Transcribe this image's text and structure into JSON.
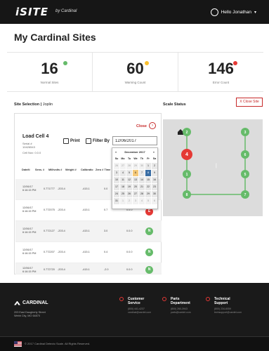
{
  "header": {
    "logo": "iSITE",
    "logo_sub": "by Cardinal",
    "user_greeting": "Hello Jonathan"
  },
  "page": {
    "title": "My Cardinal Sites"
  },
  "stats": [
    {
      "value": "16",
      "label": "Normal Sites",
      "color": "#66bb6a"
    },
    {
      "value": "60",
      "label": "Warning Count",
      "color": "#fbc02d"
    },
    {
      "value": "146",
      "label": "Error Count",
      "color": "#e53935"
    }
  ],
  "site_selection": {
    "label": "Site Selection",
    "site": "Joplin"
  },
  "scale_status": {
    "label": "Scale Status",
    "close_all": "X Close Site"
  },
  "load_cell": {
    "title": "Load Cell 4",
    "serial_label": "Serial #",
    "serial": "10426543",
    "cell_no": "Cell Nov: 0.0.0",
    "close_label": "Close",
    "print_label": "Print",
    "filter_label": "Filter By",
    "date_value": "12/06/2017"
  },
  "table": {
    "headers": [
      "Date/ti",
      "Sens. #",
      "Millivolts #",
      "Weight #",
      "Calibratio",
      "Zero # Time"
    ],
    "rows": [
      {
        "date": "12/06/17 6:16:15 PM",
        "sensor": "0.771777",
        "mv": "-203.4",
        "weight": "-415.1",
        "cal": "0.0",
        "zero": "",
        "status": "",
        "status_type": "none"
      },
      {
        "date": "12/06/17 6:16:15 PM",
        "sensor": "0.772075",
        "mv": "-203.4",
        "weight": "-415.1",
        "cal": "0.7",
        "zero": "0.0.0",
        "status": "E",
        "status_type": "red"
      },
      {
        "date": "12/06/17 6:16:15 PM",
        "sensor": "0.772127",
        "mv": "-203.4",
        "weight": "-415.1",
        "cal": "3.0",
        "zero": "0.0.0",
        "status": "N",
        "status_type": "green"
      },
      {
        "date": "12/06/17 6:16:15 PM",
        "sensor": "0.772207",
        "mv": "-203.4",
        "weight": "-415.1",
        "cal": "0.4",
        "zero": "0.0.0",
        "status": "N",
        "status_type": "green"
      },
      {
        "date": "12/06/17 6:16:15 PM",
        "sensor": "0.772720",
        "mv": "-203.4",
        "weight": "-415.1",
        "cal": "-2.0",
        "zero": "0.0.0",
        "status": "N",
        "status_type": "green"
      }
    ]
  },
  "calendar": {
    "month": "December 2017",
    "prev": "«",
    "next": "»",
    "dow": [
      "Su",
      "Mo",
      "Tu",
      "We",
      "Th",
      "Fr",
      "Sa"
    ],
    "weeks": [
      [
        "26",
        "27",
        "28",
        "29",
        "30",
        "1",
        "2"
      ],
      [
        "3",
        "4",
        "5",
        "6",
        "7",
        "8",
        "9"
      ],
      [
        "10",
        "11",
        "12",
        "13",
        "14",
        "15",
        "16"
      ],
      [
        "17",
        "18",
        "19",
        "20",
        "21",
        "22",
        "23"
      ],
      [
        "24",
        "25",
        "26",
        "27",
        "28",
        "29",
        "30"
      ],
      [
        "31",
        "1",
        "2",
        "3",
        "4",
        "5",
        "6"
      ]
    ],
    "selected_day": "6",
    "today_day": "8"
  },
  "scale_nodes": [
    {
      "label": "2",
      "color": "#66bb6a"
    },
    {
      "label": "3",
      "color": "#66bb6a"
    },
    {
      "label": "4",
      "color": "#e53935"
    },
    {
      "label": "6",
      "color": "#66bb6a"
    },
    {
      "label": "5",
      "color": "#66bb6a"
    },
    {
      "label": "1",
      "color": "#66bb6a"
    },
    {
      "label": "8",
      "color": "#66bb6a"
    },
    {
      "label": "7",
      "color": "#66bb6a"
    }
  ],
  "footer": {
    "brand": "CARDINAL",
    "address_1": "203 East Daugherty Street",
    "address_2": "Webb City, MO 64870",
    "cols": [
      {
        "title_1": "Customer",
        "title_2": "Service",
        "line_1": "(800) 441-4237",
        "line_2": "cardinal@cardet.com"
      },
      {
        "title_1": "Parts",
        "title_2": "Department",
        "line_1": "(800) 260-3943",
        "line_2": "parts@cardet.com"
      },
      {
        "title_1": "Technical",
        "title_2": "Support",
        "line_1": "(800) 234-6059",
        "line_2": "techsupport@cardet.com"
      }
    ],
    "copyright": "© 2017 Cardinal Detecto Scale. All Rights Reserved."
  }
}
